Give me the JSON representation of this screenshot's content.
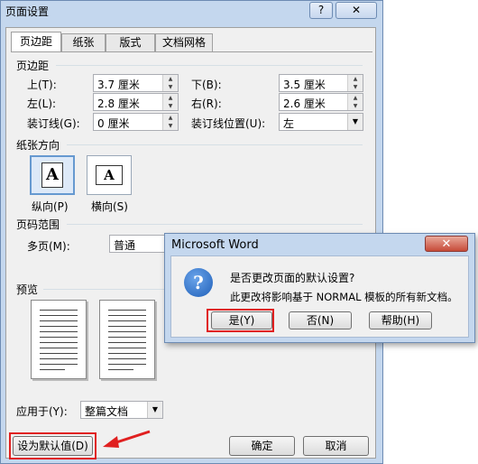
{
  "dialog": {
    "title": "页面设置",
    "help_button": "?",
    "close_button": "✕",
    "tabs": [
      "页边距",
      "纸张",
      "版式",
      "文档网格"
    ],
    "margins": {
      "section": "页边距",
      "top_label": "上(T):",
      "top_value": "3.7 厘米",
      "bottom_label": "下(B):",
      "bottom_value": "3.5 厘米",
      "left_label": "左(L):",
      "left_value": "2.8 厘米",
      "right_label": "右(R):",
      "right_value": "2.6 厘米",
      "gutter_label": "装订线(G):",
      "gutter_value": "0 厘米",
      "gutter_pos_label": "装订线位置(U):",
      "gutter_pos_value": "左"
    },
    "orientation": {
      "section": "纸张方向",
      "portrait_label": "纵向(P)",
      "landscape_label": "横向(S)",
      "glyph": "A"
    },
    "pages": {
      "section": "页码范围",
      "multiple_label": "多页(M):",
      "multiple_value": "普通"
    },
    "preview": {
      "section": "预览"
    },
    "apply": {
      "label": "应用于(Y):",
      "value": "整篇文档"
    },
    "buttons": {
      "default": "设为默认值(D)",
      "ok": "确定",
      "cancel": "取消"
    }
  },
  "message_box": {
    "title": "Microsoft Word",
    "close": "✕",
    "icon": "?",
    "line1": "是否更改页面的默认设置?",
    "line2": "此更改将影响基于 NORMAL 模板的所有新文档。",
    "yes": "是(Y)",
    "no": "否(N)",
    "help": "帮助(H)"
  },
  "colors": {
    "frame": "#c4d7ee",
    "highlight": "#e02020",
    "annotation_arrow": "#e02020"
  }
}
